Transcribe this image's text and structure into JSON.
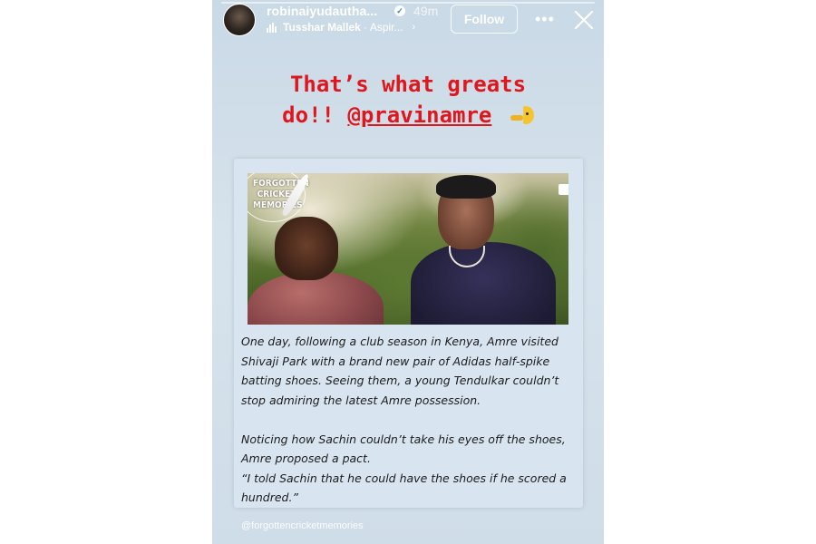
{
  "header": {
    "username": "robinaiyudautha...",
    "time": "49m",
    "music_artist": "Tusshar Mallek",
    "music_separator": "·",
    "music_song": "Aspir...",
    "follow_label": "Follow",
    "more_label": "•••"
  },
  "caption": {
    "line1": "That’s what greats",
    "line2_text": "do!! ",
    "mention": "@pravinamre"
  },
  "post_card": {
    "photo_watermark": "FORGOTTEN CRICKET MEMORIES",
    "paragraphs": [
      "One day, following a club season in Kenya, Amre visited Shivaji Park with a brand new pair of Adidas half-spike batting shoes. Seeing them, a young Tendulkar couldn’t stop admiring the latest Amre possession.",
      "Noticing how Sachin couldn’t take his eyes off the shoes, Amre proposed a pact.",
      "“I told Sachin that he could have the shoes if he scored a hundred.”"
    ]
  },
  "footer": {
    "credit": "@forgottencricketmemories"
  },
  "colors": {
    "caption_red": "#e0161d",
    "story_background": "#d3e0ea",
    "card_background": "#d8e5f1"
  },
  "icons": {
    "verified": "verified-check-icon",
    "music": "audio-waveform-icon",
    "chevron": "chevron-right-icon",
    "more": "more-horizontal-icon",
    "close": "close-x-icon",
    "emoji": "face-peeking-emoji"
  }
}
